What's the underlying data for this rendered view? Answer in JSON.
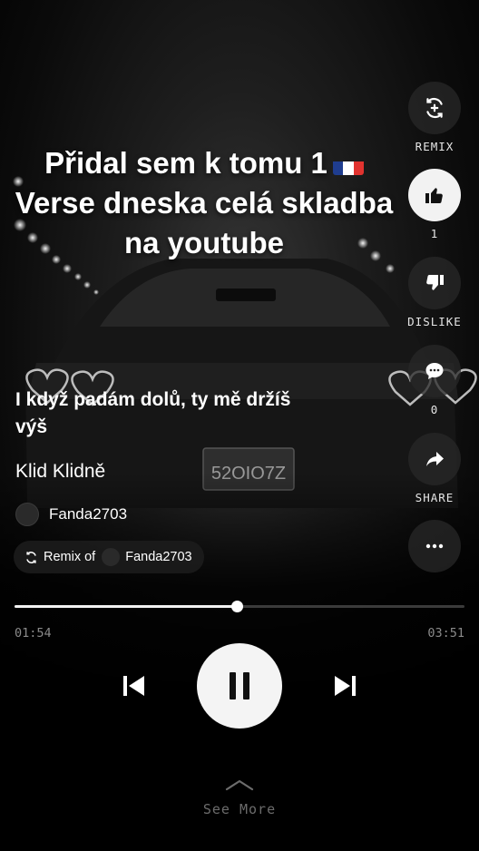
{
  "overlay": {
    "line1": "Přidal sem k tomu 1",
    "line2": "Verse dneska celá skladba",
    "line3": "na youtube",
    "flag_colors": [
      "#1f3d8f",
      "#ffffff",
      "#e1332f"
    ]
  },
  "actions": {
    "remix_label": "REMIX",
    "like_count": "1",
    "dislike_label": "DISLIKE",
    "comment_count": "0",
    "share_label": "SHARE",
    "icons": [
      "remix-icon",
      "thumbs-up-icon",
      "thumbs-down-icon",
      "comment-icon",
      "share-icon",
      "more-icon"
    ]
  },
  "song": {
    "lyric": "I když padám dolů, ty mě držíš výš",
    "title": "Klid Klidně",
    "artist": "Fanda2703"
  },
  "remix": {
    "prefix": "Remix of",
    "artist": "Fanda2703"
  },
  "player": {
    "current_time": "01:54",
    "total_time": "03:51",
    "progress": 0.493,
    "state": "playing"
  },
  "footer": {
    "see_more": "See More"
  },
  "colors": {
    "accent": "#f2f2f2",
    "muted": "#8a8a8a",
    "track": "#3b3b3b"
  }
}
